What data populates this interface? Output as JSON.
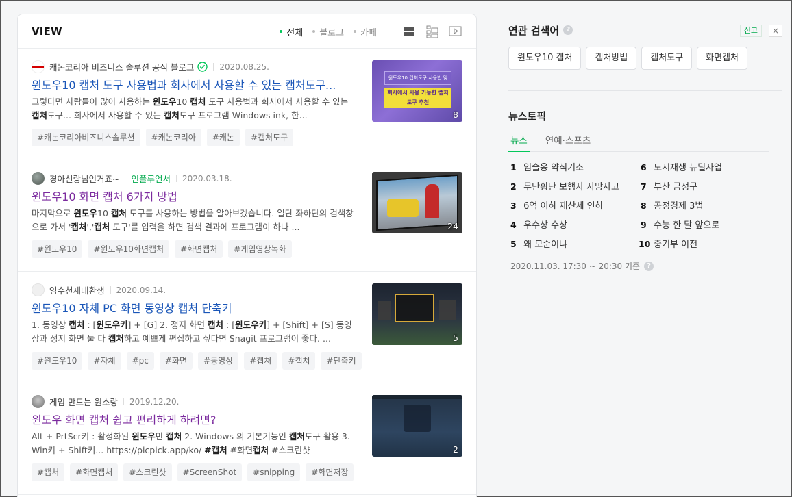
{
  "view": {
    "title": "VIEW",
    "filters": [
      {
        "label": "전체",
        "active": true
      },
      {
        "label": "블로그",
        "active": false
      },
      {
        "label": "카페",
        "active": false
      }
    ],
    "accent_color": "#03c75a"
  },
  "results": [
    {
      "author": "캐논코리아 비즈니스 솔루션 공식 블로그",
      "author_badge": "verified-check-icon",
      "date": "2020.08.25.",
      "title": "윈도우10 캡처 도구 사용법과 회사에서 사용할 수 있는 캡처도구...",
      "title_state": "link",
      "description_html": "그렇다면 사람들이 많이 사용하는 <b>윈도우</b>10 <b>캡처</b> 도구 사용법과 회사에서 사용할 수 있는 <b>캡처</b>도구... 회사에서 사용할 수 있는 <b>캡처</b>도구 프로그램 Windows ink, 한...",
      "tags": [
        "#캐논코리아비즈니스솔루션",
        "#캐논코리아",
        "#캐논",
        "#캡처도구"
      ],
      "thumb_caption_1": "윈도우10 캡처도구 사용법 및",
      "thumb_caption_2": "회사에서 사용 가능한 캡처도구 추천",
      "thumb_count": "8"
    },
    {
      "author": "경아신랑님인거죠~",
      "influencer": "인플루언서",
      "date": "2020.03.18.",
      "title": "윈도우10 화면 캡처 6가지 방법",
      "title_state": "visited",
      "description_html": "마지막으로 <b>윈도우</b>10 <b>캡처</b> 도구를 사용하는 방법을 알아보겠습니다. 일단 좌하단의 검색창으로 가서 '<b>캡처</b>','<b>캡처</b> 도구'를 입력을 하면 검색 결과에 프로그램이 하나 ...",
      "tags": [
        "#윈도우10",
        "#윈도우10화면캡처",
        "#화면캡처",
        "#게임영상녹화"
      ],
      "thumb_count": "24"
    },
    {
      "author": "영수천재대환생",
      "date": "2020.09.14.",
      "title": "윈도우10 자체 PC 화면 동영상 캡처 단축키",
      "title_state": "link",
      "description_html": "1. 동영상 <b>캡처</b> : [<b>윈도우키</b>] + [G] 2. 정지 화면 <b>캡처</b> : [<b>윈도우키</b>] + [Shift] + [S] 동영상과 정지 화면 둘 다 <b>캡처</b>하고 예쁘게 편집하고 싶다면 Snagit 프로그램이 좋다. ...",
      "tags": [
        "#윈도우10",
        "#자체",
        "#pc",
        "#화면",
        "#동영상",
        "#캡처",
        "#캡쳐",
        "#단축키"
      ],
      "thumb_count": "5"
    },
    {
      "author": "게임 만드는 원소랑",
      "date": "2019.12.20.",
      "title": "윈도우 화면 캡처 쉽고 편리하게 하려면?",
      "title_state": "visited",
      "description_html": "Alt + PrtScr키 : 활성화된 <b>윈도우</b>만 <b>캡처</b> 2. Windows 의 기본기능인 <b>캡처</b>도구 활용 3. Win키 + Shift키... https://picpick.app/ko/ <b>#캡처</b> #화면<b>캡처</b> #스크린샷 #Screen...",
      "tags": [
        "#캡처",
        "#화면캡처",
        "#스크린샷",
        "#ScreenShot",
        "#snipping",
        "#화면저장"
      ],
      "thumb_count": "2"
    }
  ],
  "related": {
    "title": "연관 검색어",
    "report_label": "신고",
    "close_label": "×",
    "help_label": "?",
    "keywords": [
      "윈도우10 캡처",
      "캡처방법",
      "캡처도구",
      "화면캡처"
    ]
  },
  "news_topic": {
    "title": "뉴스토픽",
    "tabs": [
      {
        "label": "뉴스",
        "active": true
      },
      {
        "label": "연예·스포츠",
        "active": false
      }
    ],
    "items": [
      {
        "rank": "1",
        "text": "임슬옹 약식기소"
      },
      {
        "rank": "2",
        "text": "무단횡단 보행자 사망사고"
      },
      {
        "rank": "3",
        "text": "6억 이하 재산세 인하"
      },
      {
        "rank": "4",
        "text": "우수상 수상"
      },
      {
        "rank": "5",
        "text": "왜 모순이냐"
      },
      {
        "rank": "6",
        "text": "도시재생 뉴딜사업"
      },
      {
        "rank": "7",
        "text": "부산 금정구"
      },
      {
        "rank": "8",
        "text": "공정경제 3법"
      },
      {
        "rank": "9",
        "text": "수능 한 달 앞으로"
      },
      {
        "rank": "10",
        "text": "중기부 이전"
      }
    ],
    "timestamp": "2020.11.03. 17:30 ~ 20:30 기준"
  }
}
